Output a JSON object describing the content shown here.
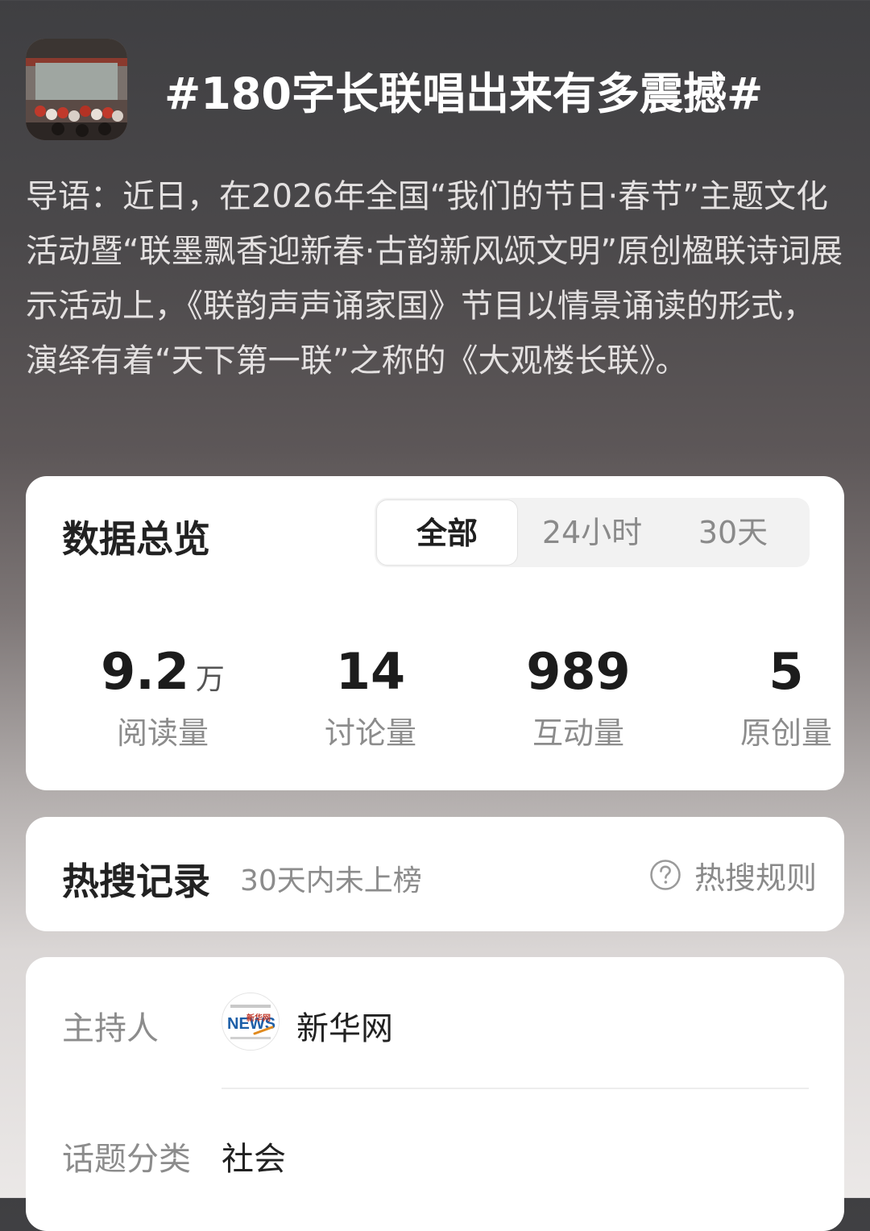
{
  "topic": {
    "title": "#180字长联唱出来有多震撼#",
    "thumbnail_icon": "performance-photo",
    "intro": "导语：近日，在2026年全国“我们的节日·春节”主题文化活动暨“联墨飘香迎新春·古韵新风颂文明”原创楹联诗词展示活动上，《联韵声声诵家国》节目以情景诵读的形式，演绎有着“天下第一联”之称的《大观楼长联》。"
  },
  "overview": {
    "title": "数据总览",
    "tabs": [
      {
        "label": "全部",
        "active": true
      },
      {
        "label": "24小时",
        "active": false
      },
      {
        "label": "30天",
        "active": false
      }
    ],
    "stats": [
      {
        "value": "9.2",
        "unit": "万",
        "label": "阅读量"
      },
      {
        "value": "14",
        "unit": "",
        "label": "讨论量"
      },
      {
        "value": "989",
        "unit": "",
        "label": "互动量"
      },
      {
        "value": "5",
        "unit": "",
        "label": "原创量"
      }
    ]
  },
  "hot_search": {
    "title": "热搜记录",
    "subtitle": "30天内未上榜",
    "rule_icon": "help-circle-icon",
    "rule_label": "热搜规则"
  },
  "info": {
    "host_label": "主持人",
    "host_name": "新华网",
    "host_logo_icon": "xinhua-news-logo",
    "host_logo_text": "新华网",
    "host_logo_mark": "NEWS",
    "category_label": "话题分类",
    "category_value": "社会"
  },
  "colors": {
    "card_bg": "#ffffff",
    "title_text": "#ffffff",
    "muted_text": "#8c8c8c",
    "strong_text": "#1c1c1c"
  }
}
